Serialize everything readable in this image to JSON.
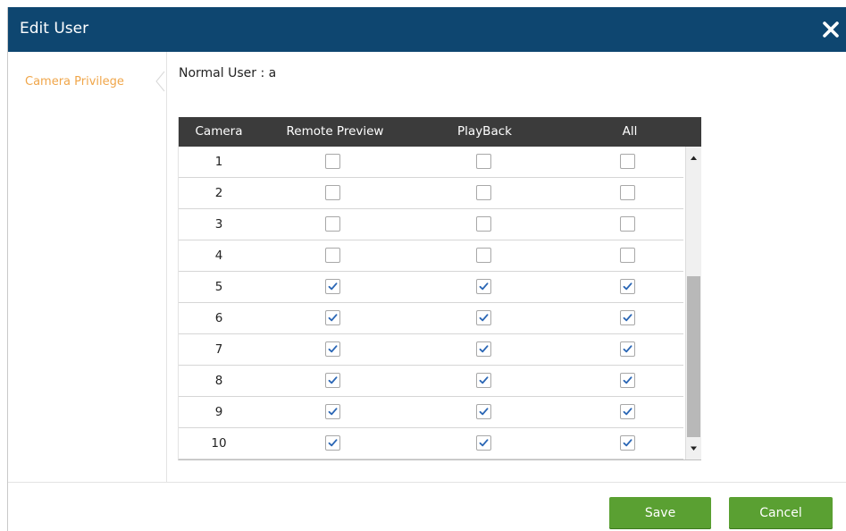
{
  "dialog": {
    "title": "Edit User",
    "close_icon": "close-icon",
    "header_color": "#0e4670"
  },
  "sidebar": {
    "items": [
      {
        "label": "Camera Privilege",
        "icon": "chevron-left-icon",
        "active": true,
        "color": "#f0a64a"
      }
    ]
  },
  "user_line": "Normal User : a",
  "table": {
    "columns": [
      "Camera",
      "Remote Preview",
      "PlayBack",
      "All"
    ],
    "rows": [
      {
        "camera": "1",
        "remote_preview": false,
        "playback": false,
        "all": false
      },
      {
        "camera": "2",
        "remote_preview": false,
        "playback": false,
        "all": false
      },
      {
        "camera": "3",
        "remote_preview": false,
        "playback": false,
        "all": false
      },
      {
        "camera": "4",
        "remote_preview": false,
        "playback": false,
        "all": false
      },
      {
        "camera": "5",
        "remote_preview": true,
        "playback": true,
        "all": true
      },
      {
        "camera": "6",
        "remote_preview": true,
        "playback": true,
        "all": true
      },
      {
        "camera": "7",
        "remote_preview": true,
        "playback": true,
        "all": true
      },
      {
        "camera": "8",
        "remote_preview": true,
        "playback": true,
        "all": true
      },
      {
        "camera": "9",
        "remote_preview": true,
        "playback": true,
        "all": true
      },
      {
        "camera": "10",
        "remote_preview": true,
        "playback": true,
        "all": true
      }
    ],
    "header_color": "#3b3b3b",
    "scroll_up_icon": "scroll-up-arrow-icon",
    "scroll_down_icon": "scroll-down-arrow-icon"
  },
  "footer": {
    "save_label": "Save",
    "cancel_label": "Cancel",
    "button_color": "#5aa032"
  }
}
